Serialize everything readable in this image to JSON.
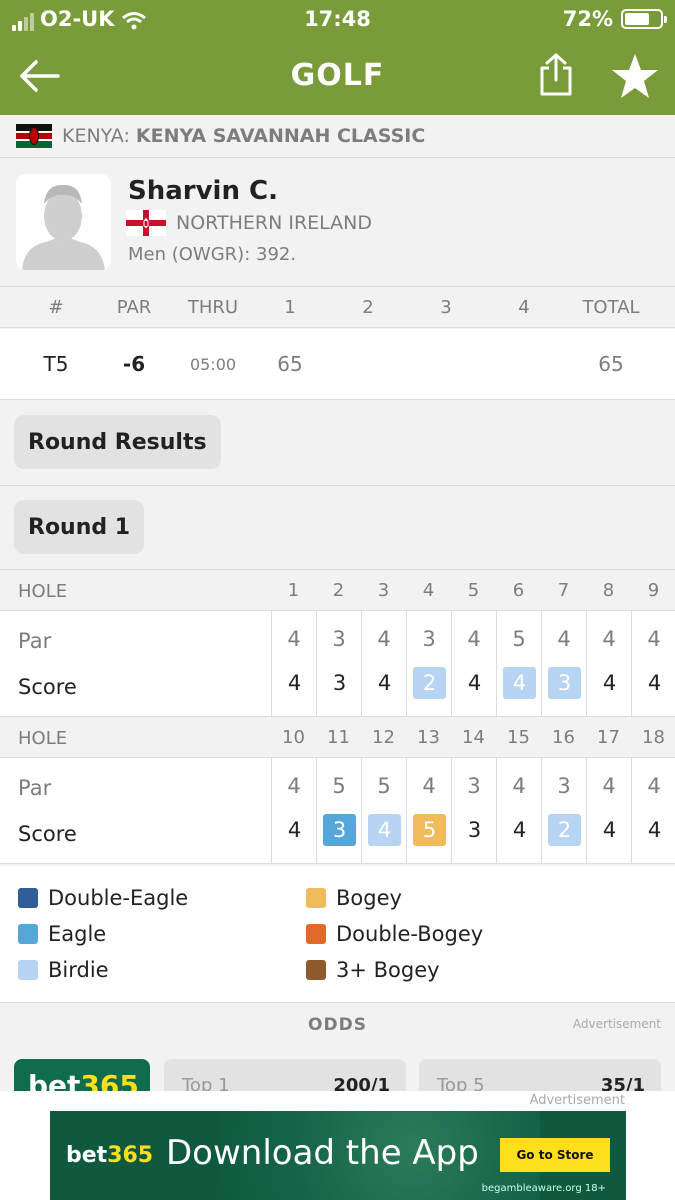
{
  "status": {
    "carrier": "O2-UK",
    "time": "17:48",
    "battery": "72%",
    "battery_level": 0.72
  },
  "header": {
    "title": "GOLF"
  },
  "tournament": {
    "country": "KENYA:",
    "name": "KENYA SAVANNAH CLASSIC"
  },
  "player": {
    "name": "Sharvin C.",
    "country": "NORTHERN IRELAND",
    "ranking": "Men (OWGR): 392."
  },
  "summary": {
    "headers": {
      "pos": "#",
      "par": "PAR",
      "thru": "THRU",
      "r1": "1",
      "r2": "2",
      "r3": "3",
      "r4": "4",
      "total": "TOTAL"
    },
    "values": {
      "pos": "T5",
      "par": "-6",
      "thru": "05:00",
      "r1": "65",
      "r2": "",
      "r3": "",
      "r4": "",
      "total": "65"
    }
  },
  "sections": {
    "round_results": "Round Results",
    "round": "Round 1"
  },
  "holes": {
    "hole_label": "HOLE",
    "par_label": "Par",
    "score_label": "Score",
    "front": {
      "numbers": [
        "1",
        "2",
        "3",
        "4",
        "5",
        "6",
        "7",
        "8",
        "9"
      ],
      "par": [
        "4",
        "3",
        "4",
        "3",
        "4",
        "5",
        "4",
        "4",
        "4"
      ],
      "score": [
        "4",
        "3",
        "4",
        "2",
        "4",
        "4",
        "3",
        "4",
        "4"
      ]
    },
    "back": {
      "numbers": [
        "10",
        "11",
        "12",
        "13",
        "14",
        "15",
        "16",
        "17",
        "18"
      ],
      "par": [
        "4",
        "5",
        "5",
        "4",
        "3",
        "4",
        "3",
        "4",
        "4"
      ],
      "score": [
        "4",
        "3",
        "4",
        "5",
        "3",
        "4",
        "2",
        "4",
        "4"
      ]
    }
  },
  "legend": {
    "double_eagle": "Double-Eagle",
    "eagle": "Eagle",
    "birdie": "Birdie",
    "bogey": "Bogey",
    "double_bogey": "Double-Bogey",
    "triple_bogey": "3+ Bogey"
  },
  "colors": {
    "header": "#7a9b3a",
    "double_eagle": "#2f5f96",
    "eagle": "#55a7da",
    "birdie": "#b7d4f3",
    "bogey": "#f0bb5b",
    "double_bogey": "#e0692a",
    "triple_bogey": "#8f5a2e"
  },
  "odds": {
    "title": "ODDS",
    "ad_label": "Advertisement",
    "brand_a": "bet",
    "brand_b": "365",
    "top1_label": "Top 1",
    "top1_value": "200/1",
    "top5_label": "Top 5",
    "top5_value": "35/1"
  },
  "banner": {
    "ad_label": "Advertisement",
    "brand_a": "bet",
    "brand_b": "365",
    "headline": "Download the App",
    "cta": "Go to Store",
    "footer": "begambleaware.org 18+"
  }
}
